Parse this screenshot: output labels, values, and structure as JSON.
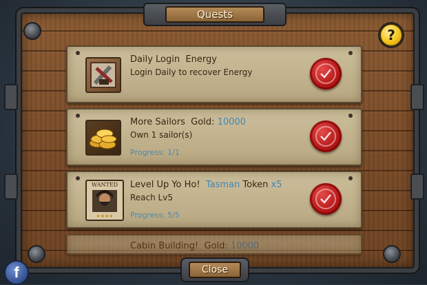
{
  "window": {
    "title": "Quests",
    "help_label": "?",
    "close_label": "Close"
  },
  "social": {
    "facebook_label": "f"
  },
  "quests": [
    {
      "name_label": "Daily Login",
      "reward_type": "Energy",
      "reward_value": "",
      "description": "Login Daily to recover Energy",
      "progress": "",
      "icon": "energy-potion-icon",
      "status": "completed"
    },
    {
      "name_label": "More Sailors",
      "reward_type": "Gold:",
      "reward_value": "10000",
      "description": "Own 1 sailor(s)",
      "progress": "Progress: 1/1",
      "icon": "gold-coins-icon",
      "status": "completed"
    },
    {
      "name_label": "Level Up Yo Ho!",
      "reward_prefix": "Tasman",
      "reward_type": "Token",
      "reward_value": "x5",
      "description": "Reach Lv5",
      "progress": "Progress: 5/5",
      "icon": "wanted-poster-icon",
      "icon_caption": "WANTED",
      "status": "completed"
    },
    {
      "name_label": "Cabin Building!",
      "reward_type": "Gold:",
      "reward_value": "10000",
      "status": "partially-visible"
    }
  ],
  "colors": {
    "wood": "#7a4c28",
    "parchment": "#c6b792",
    "seal": "#b31818",
    "link_blue": "#3f86b5"
  }
}
